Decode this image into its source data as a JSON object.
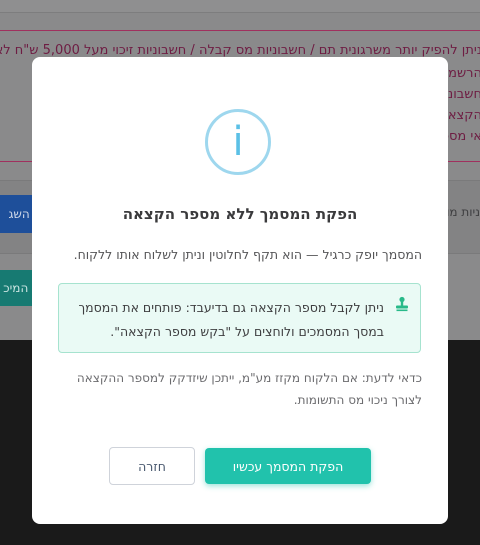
{
  "background": {
    "alert_lines": [
      "ניתן להפיק יותר משרגונית תם / חשבוניות מס קבלה / חשבוניות זיכוי מעל 5,000 ש\"ח לא כ",
      "הרשמ... ריט ב",
      "חשבוניות יי",
      "הקצאה על... ת המכ",
      "אי מספ"
    ],
    "panel_text": "ניות מול",
    "blue_button_label": "ך השג",
    "teal_button_label": "ת המיכ"
  },
  "modal": {
    "icon": "info-icon",
    "icon_glyph": "i",
    "title": "הפקת המסמך ללא מספר הקצאה",
    "body": "המסמך יופק כרגיל — הוא תקף לחלוטין וניתן לשלוח אותו ללקוח.",
    "tip": {
      "icon": "stamp-icon",
      "text": "ניתן לקבל מספר הקצאה גם בדיעבד: פותחים את המסמך במסך המסמכים ולוחצים על \"בקש מספר הקצאה\"."
    },
    "note": "כדאי לדעת: אם הלקוח מקזז מע\"מ, ייתכן שיזדקק למספר ההקצאה לצורך ניכוי מס התשומות.",
    "primary_button": "הפקת המסמך עכשיו",
    "secondary_button": "חזרה"
  },
  "colors": {
    "accent": "#21c2ac",
    "info": "#5bc0e6",
    "tip_bg": "#eafaf5",
    "overlay": "#8f8f90"
  }
}
